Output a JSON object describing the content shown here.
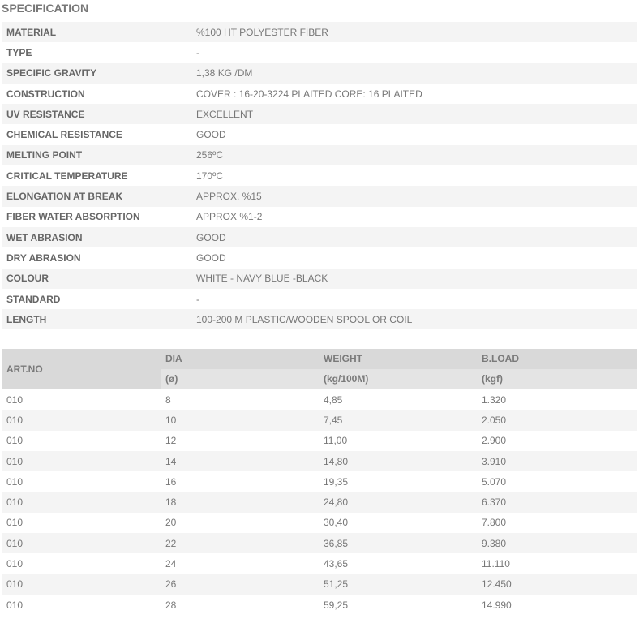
{
  "heading": "SPECIFICATION",
  "specification": [
    {
      "label": "MATERIAL",
      "value": "%100 HT POLYESTER FİBER"
    },
    {
      "label": "TYPE",
      "value": "-"
    },
    {
      "label": "SPECIFIC GRAVITY",
      "value": "1,38 KG /DM"
    },
    {
      "label": "CONSTRUCTION",
      "value": "COVER : 16-20-3224 PLAITED CORE: 16 PLAITED"
    },
    {
      "label": "UV RESISTANCE",
      "value": "EXCELLENT"
    },
    {
      "label": "CHEMICAL RESISTANCE",
      "value": "GOOD"
    },
    {
      "label": "MELTING POINT",
      "value": "256ºC"
    },
    {
      "label": "CRITICAL TEMPERATURE",
      "value": "170ºC"
    },
    {
      "label": "ELONGATION AT BREAK",
      "value": "APPROX. %15"
    },
    {
      "label": "FIBER WATER ABSORPTION",
      "value": "APPROX %1-2"
    },
    {
      "label": "WET ABRASION",
      "value": "GOOD"
    },
    {
      "label": "DRY ABRASION",
      "value": "GOOD"
    },
    {
      "label": "COLOUR",
      "value": "WHITE - NAVY BLUE -BLACK"
    },
    {
      "label": "STANDARD",
      "value": "-"
    },
    {
      "label": "LENGTH",
      "value": "100-200 M PLASTIC/WOODEN SPOOL OR COIL"
    }
  ],
  "product_table": {
    "headers": {
      "artno": "ART.NO",
      "dia": "DIA",
      "dia_unit": "(ø)",
      "weight": "WEIGHT",
      "weight_unit": "(kg/100M)",
      "bload": "B.LOAD",
      "bload_unit": "(kgf)"
    },
    "rows": [
      {
        "artno": "010",
        "dia": "8",
        "weight": "4,85",
        "bload": "1.320"
      },
      {
        "artno": "010",
        "dia": "10",
        "weight": "7,45",
        "bload": "2.050"
      },
      {
        "artno": "010",
        "dia": "12",
        "weight": "11,00",
        "bload": "2.900"
      },
      {
        "artno": "010",
        "dia": "14",
        "weight": "14,80",
        "bload": "3.910"
      },
      {
        "artno": "010",
        "dia": "16",
        "weight": "19,35",
        "bload": "5.070"
      },
      {
        "artno": "010",
        "dia": "18",
        "weight": "24,80",
        "bload": "6.370"
      },
      {
        "artno": "010",
        "dia": "20",
        "weight": "30,40",
        "bload": "7.800"
      },
      {
        "artno": "010",
        "dia": "22",
        "weight": "36,85",
        "bload": "9.380"
      },
      {
        "artno": "010",
        "dia": "24",
        "weight": "43,65",
        "bload": "11.110"
      },
      {
        "artno": "010",
        "dia": "26",
        "weight": "51,25",
        "bload": "12.450"
      },
      {
        "artno": "010",
        "dia": "28",
        "weight": "59,25",
        "bload": "14.990"
      }
    ]
  }
}
